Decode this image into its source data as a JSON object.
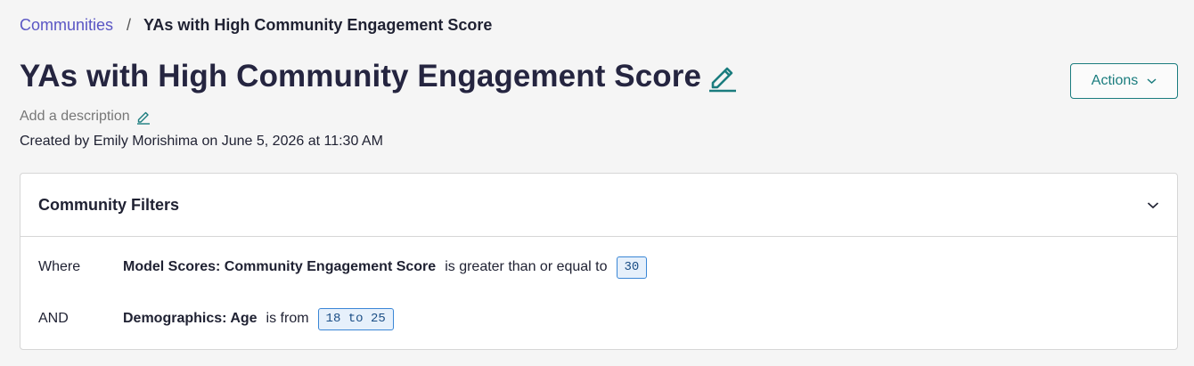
{
  "breadcrumb": {
    "parent": "Communities",
    "separator": "/",
    "current": "YAs with High Community Engagement Score"
  },
  "header": {
    "title": "YAs with High Community Engagement Score",
    "actions_label": "Actions",
    "description_placeholder": "Add a description",
    "created_line": "Created by Emily Morishima on June 5, 2026 at 11:30 AM"
  },
  "filters": {
    "title": "Community Filters",
    "rows": [
      {
        "connector": "Where",
        "field": "Model Scores: Community Engagement Score",
        "operator": "is greater than or equal to",
        "value": "30"
      },
      {
        "connector": "AND",
        "field": "Demographics: Age",
        "operator": "is from",
        "value": "18 to 25"
      }
    ]
  },
  "colors": {
    "accent_teal": "#1a7c7e",
    "link_purple": "#5a56c4",
    "chip_border": "#3a86d6",
    "chip_bg": "#e6f0fb"
  },
  "icons": {
    "title_edit": "pencil-icon",
    "description_edit": "pencil-icon",
    "actions_dropdown": "chevron-down-icon",
    "filters_toggle": "chevron-down-icon"
  }
}
